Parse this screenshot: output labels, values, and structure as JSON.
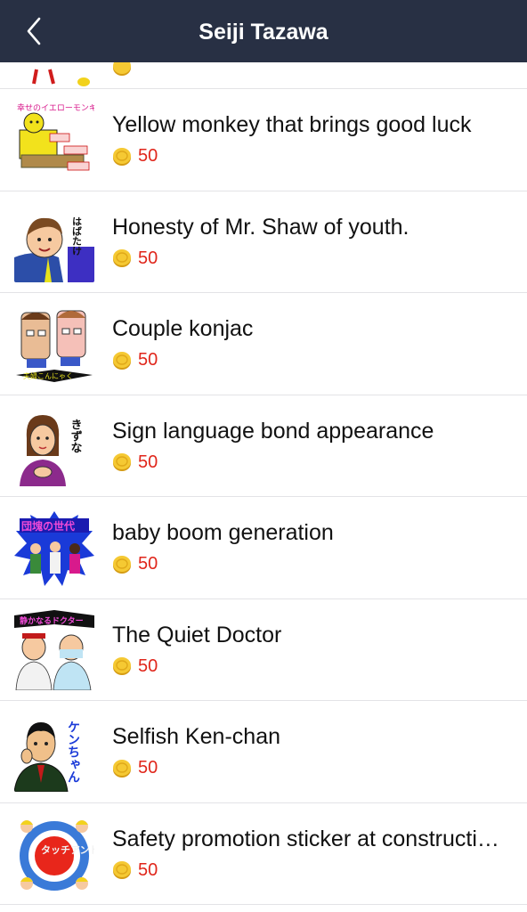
{
  "header": {
    "title": "Seiji Tazawa",
    "back_icon": "chevron-left-icon"
  },
  "colors": {
    "navbar": "#283044",
    "price": "#e0261b",
    "coin": "#f2c230"
  },
  "items": [
    {
      "title": "Yellow monkey that brings good luck",
      "price": "50",
      "thumb_caption": "幸せのイエローモンキー"
    },
    {
      "title": "Honesty of Mr. Shaw of youth.",
      "price": "50",
      "thumb_caption": "はばたけ"
    },
    {
      "title": "Couple konjac",
      "price": "50",
      "thumb_caption": "夫婦こんにゃく"
    },
    {
      "title": "Sign language bond appearance",
      "price": "50",
      "thumb_caption": "きずな"
    },
    {
      "title": "baby boom generation",
      "price": "50",
      "thumb_caption": "団塊の世代"
    },
    {
      "title": "The Quiet Doctor",
      "price": "50",
      "thumb_caption": "静かなるドクター"
    },
    {
      "title": "Selfish Ken-chan",
      "price": "50",
      "thumb_caption": "ケンちゃん"
    },
    {
      "title": "Safety promotion sticker at construction site",
      "price": "50",
      "thumb_caption": "タッチアンドコール"
    }
  ]
}
